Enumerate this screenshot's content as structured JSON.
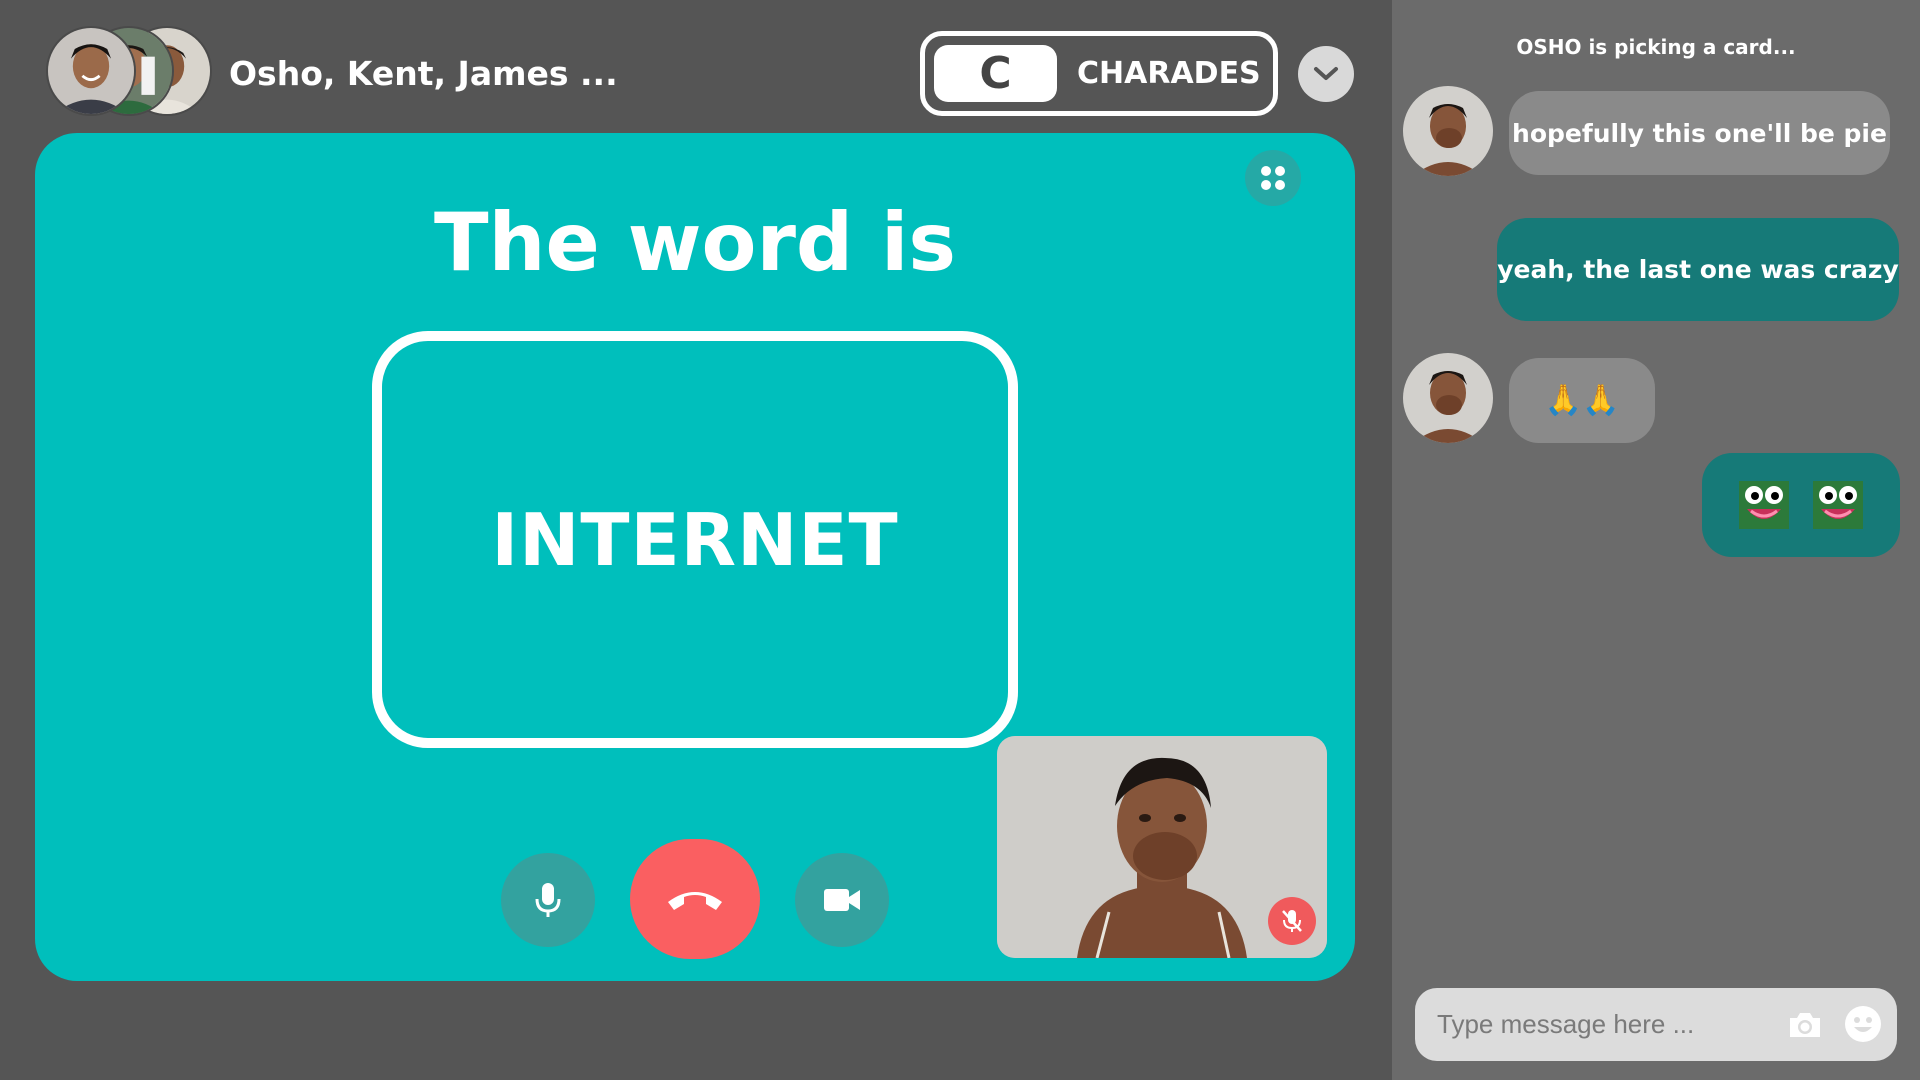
{
  "header": {
    "participants": "Osho, Kent, James ...",
    "game_letter": "C",
    "game_name": "CHARADES"
  },
  "game": {
    "title": "The word is",
    "word": "INTERNET"
  },
  "icons": {
    "dropdown": "chevron-down-icon",
    "grid": "grid-dots-icon",
    "mic": "microphone-icon",
    "end_call": "phone-hangup-icon",
    "camera": "video-camera-icon",
    "mute": "mic-muted-icon",
    "photo": "camera-icon",
    "emoji": "smiley-icon"
  },
  "chat": {
    "status": "OSHO is picking a card...",
    "messages": [
      {
        "from": "them",
        "text": "hopefully this one'll be pie"
      },
      {
        "from": "me",
        "text": "yeah, the last one was crazy"
      },
      {
        "from": "them",
        "text": "🙏🙏"
      },
      {
        "from": "me",
        "sticker": "frog-face-sticker",
        "count": 2
      }
    ],
    "composer_placeholder": "Type message here ..."
  },
  "colors": {
    "stage": "#00bfbc",
    "end_call": "#fa5f61",
    "incoming_bubble": "#8a8a8a",
    "outgoing_bubble": "#167a78",
    "background": "#555555",
    "chat_panel": "#6b6b6b"
  }
}
